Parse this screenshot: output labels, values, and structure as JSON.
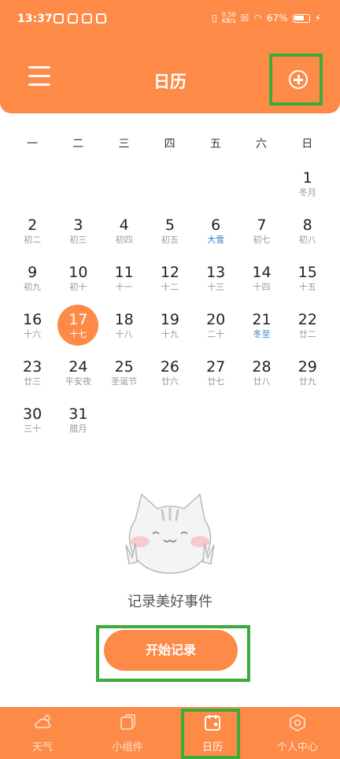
{
  "status_bar": {
    "time": "13:37",
    "net_speed_top": "0.50",
    "net_speed_bottom": "KB/s",
    "battery": "67%"
  },
  "header": {
    "title": "日历"
  },
  "weekdays": [
    "一",
    "二",
    "三",
    "四",
    "五",
    "六",
    "日"
  ],
  "calendar": {
    "today": "17",
    "days": [
      {
        "num": "",
        "sub": ""
      },
      {
        "num": "",
        "sub": ""
      },
      {
        "num": "",
        "sub": ""
      },
      {
        "num": "",
        "sub": ""
      },
      {
        "num": "",
        "sub": ""
      },
      {
        "num": "",
        "sub": ""
      },
      {
        "num": "1",
        "sub": "冬月"
      },
      {
        "num": "2",
        "sub": "初二"
      },
      {
        "num": "3",
        "sub": "初三"
      },
      {
        "num": "4",
        "sub": "初四"
      },
      {
        "num": "5",
        "sub": "初五"
      },
      {
        "num": "6",
        "sub": "大雪",
        "highlight": true
      },
      {
        "num": "7",
        "sub": "初七"
      },
      {
        "num": "8",
        "sub": "初八"
      },
      {
        "num": "9",
        "sub": "初九"
      },
      {
        "num": "10",
        "sub": "初十"
      },
      {
        "num": "11",
        "sub": "十一"
      },
      {
        "num": "12",
        "sub": "十二"
      },
      {
        "num": "13",
        "sub": "十三"
      },
      {
        "num": "14",
        "sub": "十四"
      },
      {
        "num": "15",
        "sub": "十五"
      },
      {
        "num": "16",
        "sub": "十六"
      },
      {
        "num": "17",
        "sub": "十七"
      },
      {
        "num": "18",
        "sub": "十八"
      },
      {
        "num": "19",
        "sub": "十九"
      },
      {
        "num": "20",
        "sub": "二十"
      },
      {
        "num": "21",
        "sub": "冬至",
        "highlight": true
      },
      {
        "num": "22",
        "sub": "廿二"
      },
      {
        "num": "23",
        "sub": "廿三"
      },
      {
        "num": "24",
        "sub": "平安夜"
      },
      {
        "num": "25",
        "sub": "圣诞节"
      },
      {
        "num": "26",
        "sub": "廿六"
      },
      {
        "num": "27",
        "sub": "廿七"
      },
      {
        "num": "28",
        "sub": "廿八"
      },
      {
        "num": "29",
        "sub": "廿九"
      },
      {
        "num": "30",
        "sub": "三十"
      },
      {
        "num": "31",
        "sub": "腊月"
      }
    ]
  },
  "empty_state": {
    "message": "记录美好事件",
    "button": "开始记录"
  },
  "tabs": [
    {
      "label": "天气",
      "icon": "weather-icon"
    },
    {
      "label": "小组件",
      "icon": "widget-icon"
    },
    {
      "label": "日历",
      "icon": "calendar-icon",
      "active": true
    },
    {
      "label": "个人中心",
      "icon": "profile-icon"
    }
  ],
  "colors": {
    "accent": "#fd8a47",
    "highlight_box": "#3bab3b",
    "solar_term": "#2b7bd1"
  }
}
